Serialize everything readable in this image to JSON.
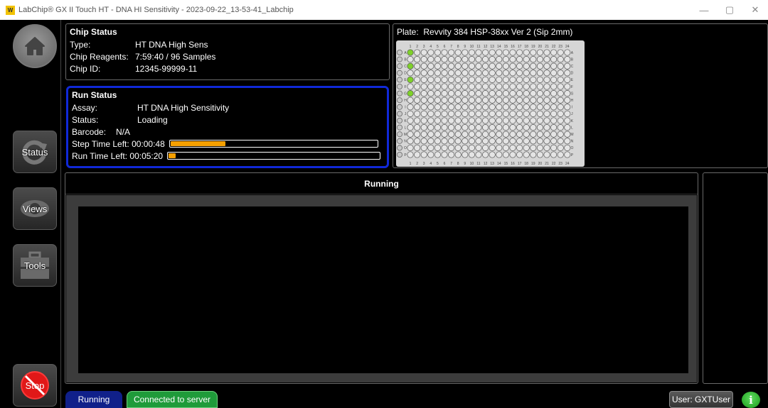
{
  "window": {
    "logo": "W",
    "title": "LabChip® GX II Touch HT - DNA HI Sensitivity - 2023-09-22_13-53-41_Labchip",
    "minimize": "—",
    "maximize": "▢",
    "close": "✕"
  },
  "sidebar": {
    "status_label": "Status",
    "views_label": "Views",
    "tools_label": "Tools",
    "stop_label": "Stop"
  },
  "chip_status": {
    "heading": "Chip Status",
    "type_key": "Type:",
    "type_value": "HT DNA High Sens",
    "reagents_key": "Chip Reagents:",
    "reagents_value": "7:59:40 / 96 Samples",
    "id_key": "Chip ID:",
    "id_value": "12345-99999-11"
  },
  "run_status": {
    "heading": "Run Status",
    "assay_key": "Assay:",
    "assay_value": "HT DNA High Sensitivity",
    "status_key": "Status:",
    "status_value": "Loading",
    "barcode_key": "Barcode:",
    "barcode_value": "N/A",
    "step_key": "Step Time Left:",
    "step_value": "00:00:48",
    "step_progress": 0.27,
    "run_key": "Run Time Left:",
    "run_value": "00:05:20",
    "run_progress": 0.04,
    "progress_color": "#f5a000"
  },
  "plate": {
    "label": "Plate:",
    "name": "Revvity 384 HSP-38xx Ver 2 (Sip 2mm)",
    "rows": [
      "A",
      "B",
      "C",
      "D",
      "E",
      "F",
      "G",
      "H",
      "I",
      "J",
      "K",
      "L",
      "M",
      "N",
      "O",
      "P"
    ],
    "columns": [
      "1",
      "2",
      "3",
      "4",
      "5",
      "6",
      "7",
      "8",
      "9",
      "10",
      "11",
      "12",
      "13",
      "14",
      "15",
      "16",
      "17",
      "18",
      "19",
      "20",
      "21",
      "22",
      "23",
      "24"
    ],
    "highlighted_wells": [
      "A1",
      "C1",
      "E1",
      "G1"
    ],
    "highlight_color": "#7fd12a"
  },
  "running": {
    "header": "Running"
  },
  "bottom_bar": {
    "running_label": "Running",
    "connection_label": "Connected to server",
    "user_label": "User: GXTUser",
    "info_label": "i"
  }
}
